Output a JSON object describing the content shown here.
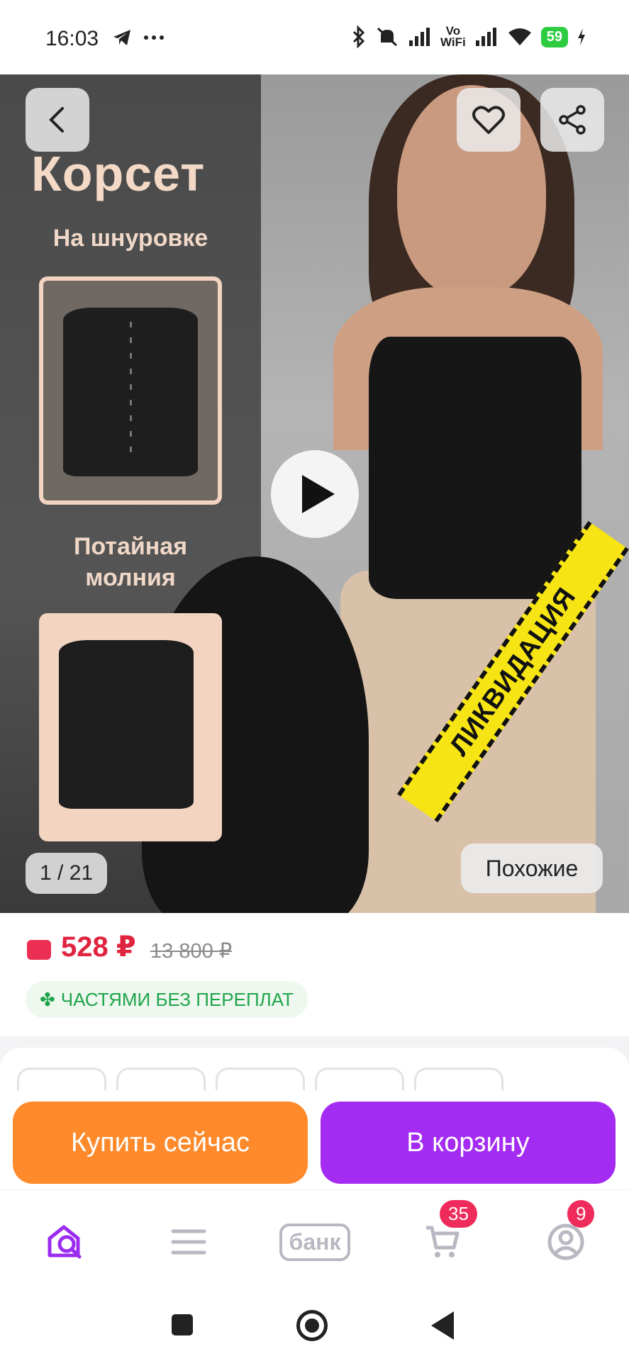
{
  "status_bar": {
    "time": "16:03",
    "left_icons": [
      "telegram-icon",
      "more-dots-icon"
    ],
    "right_icons": [
      "bluetooth-icon",
      "mute-icon",
      "signal-icon",
      "vowifi-icon",
      "signal-icon",
      "wifi-icon"
    ],
    "vowifi_label_top": "Vo",
    "vowifi_label_bottom": "WiFi",
    "battery": "59"
  },
  "gallery": {
    "promo_title": "Корсет",
    "promo_sub1": "На шнуровке",
    "promo_sub2": "Потайная молния",
    "counter": "1 / 21",
    "similar_label": "Похожие",
    "ribbon_text": "ЛИКВИДАЦИЯ"
  },
  "price": {
    "current": "528 ₽",
    "old": "13 800 ₽",
    "installments": "ЧАСТЯМИ БЕЗ ПЕРЕПЛАТ",
    "accent_color": "#e0233f",
    "installments_color": "#1fa44b"
  },
  "actions": {
    "buy_now": "Купить сейчас",
    "add_to_cart": "В корзину",
    "buy_color": "#ff8a2b",
    "cart_color": "#a42cf2"
  },
  "bottom_nav": {
    "items": [
      {
        "name": "home-search",
        "icon": "home-search-icon"
      },
      {
        "name": "catalog",
        "icon": "menu-icon"
      },
      {
        "name": "bank",
        "label": "банк"
      },
      {
        "name": "cart",
        "icon": "cart-icon",
        "badge": "35"
      },
      {
        "name": "profile",
        "icon": "profile-icon",
        "badge": "9"
      }
    ]
  }
}
